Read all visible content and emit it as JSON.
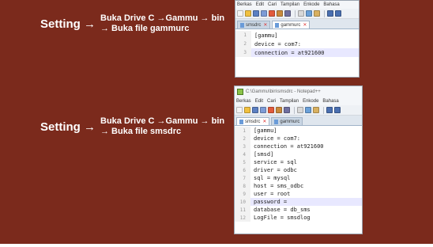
{
  "steps": [
    {
      "label": "Setting →",
      "line1": "Buka Drive C →Gammu → bin",
      "line2": "→ Buka file gammurc"
    },
    {
      "label": "Setting →",
      "line1": "Buka Drive C →Gammu → bin",
      "line2": "→ Buka file smsdrc"
    }
  ],
  "window1": {
    "menu": [
      "Berkas",
      "Edit",
      "Cari",
      "Tampilan",
      "Enkode",
      "Bahasa"
    ],
    "tabs": [
      {
        "label": "smsdrc"
      },
      {
        "label": "gammurc"
      }
    ],
    "active_tab": 1,
    "lines": [
      {
        "num": "1",
        "code": "[gammu]"
      },
      {
        "num": "2",
        "code": "device = com7:"
      },
      {
        "num": "3",
        "code": "connection = at921600"
      }
    ],
    "highlighted_line": 3
  },
  "window2": {
    "title": "C:\\Gammu\\bin\\smsdrc - Notepad++",
    "menu": [
      "Berkas",
      "Edit",
      "Cari",
      "Tampilan",
      "Enkode",
      "Bahasa"
    ],
    "tabs": [
      {
        "label": "smsdrc"
      },
      {
        "label": "gammurc"
      }
    ],
    "active_tab": 0,
    "lines": [
      {
        "num": "1",
        "code": "[gammu]"
      },
      {
        "num": "2",
        "code": "device = com7:"
      },
      {
        "num": "3",
        "code": "connection = at921600"
      },
      {
        "num": "4",
        "code": "[smsd]"
      },
      {
        "num": "5",
        "code": "service = sql"
      },
      {
        "num": "6",
        "code": "driver = odbc"
      },
      {
        "num": "7",
        "code": "sql = mysql"
      },
      {
        "num": "8",
        "code": "host = sms_odbc"
      },
      {
        "num": "9",
        "code": "user = root"
      },
      {
        "num": "10",
        "code": "password ="
      },
      {
        "num": "11",
        "code": "database = db_sms"
      },
      {
        "num": "12",
        "code": "LogFile = smsdlog"
      }
    ],
    "highlighted_line": 10
  },
  "colors": {
    "slide_bg": "#7b2a1c",
    "text": "#ffffff",
    "line_highlight": "#e8e8ff"
  }
}
